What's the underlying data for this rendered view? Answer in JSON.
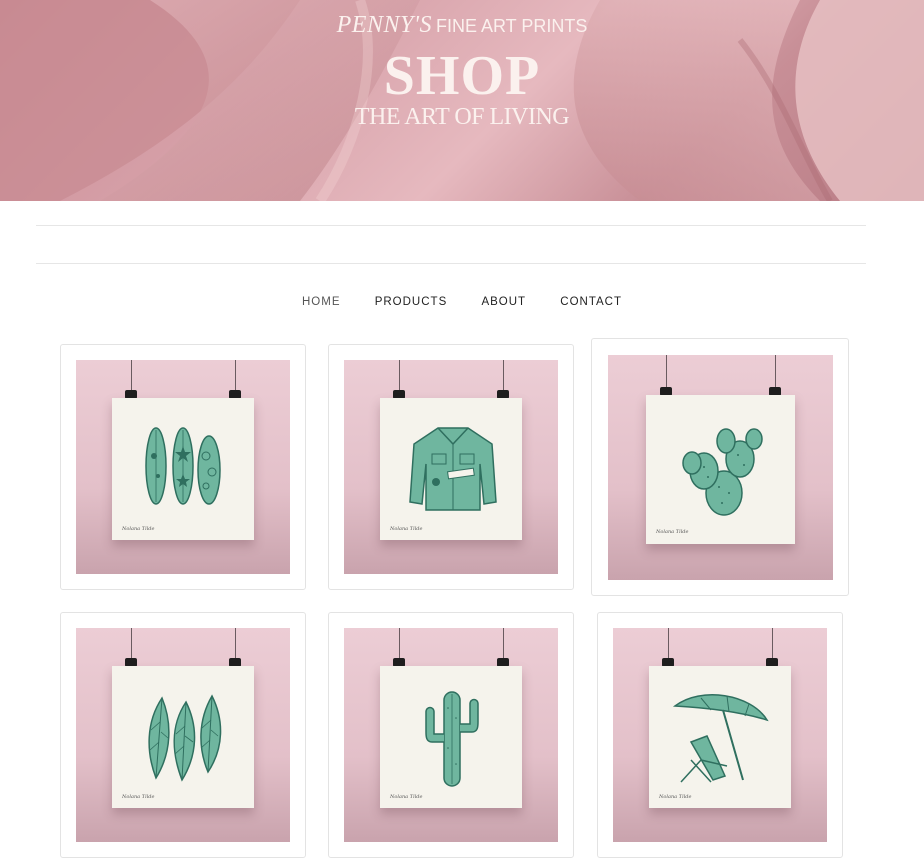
{
  "hero": {
    "brand": "PENNY'S",
    "tagline": "FINE ART PRINTS",
    "title": "SHOP",
    "subtitle": "THE ART OF LIVING"
  },
  "nav": {
    "items": [
      {
        "label": "HOME"
      },
      {
        "label": "PRODUCTS"
      },
      {
        "label": "ABOUT"
      },
      {
        "label": "CONTACT"
      }
    ]
  },
  "products": [
    {
      "subject": "surfboards-print",
      "signature": "Nolana Tilde"
    },
    {
      "subject": "denim-jacket-print",
      "signature": "Nolana Tilde"
    },
    {
      "subject": "prickly-pear-cactus-print",
      "signature": "Nolana Tilde"
    },
    {
      "subject": "tropical-leaves-print",
      "signature": "Nolana Tilde"
    },
    {
      "subject": "saguaro-cactus-print",
      "signature": "Nolana Tilde"
    },
    {
      "subject": "beach-umbrella-chair-print",
      "signature": "Nolana Tilde"
    }
  ],
  "colors": {
    "hero_pink": "#d6a0a8",
    "art_teal": "#4e9c86",
    "art_teal_dark": "#2f6f5f",
    "poster_bg": "#eccdd5"
  }
}
